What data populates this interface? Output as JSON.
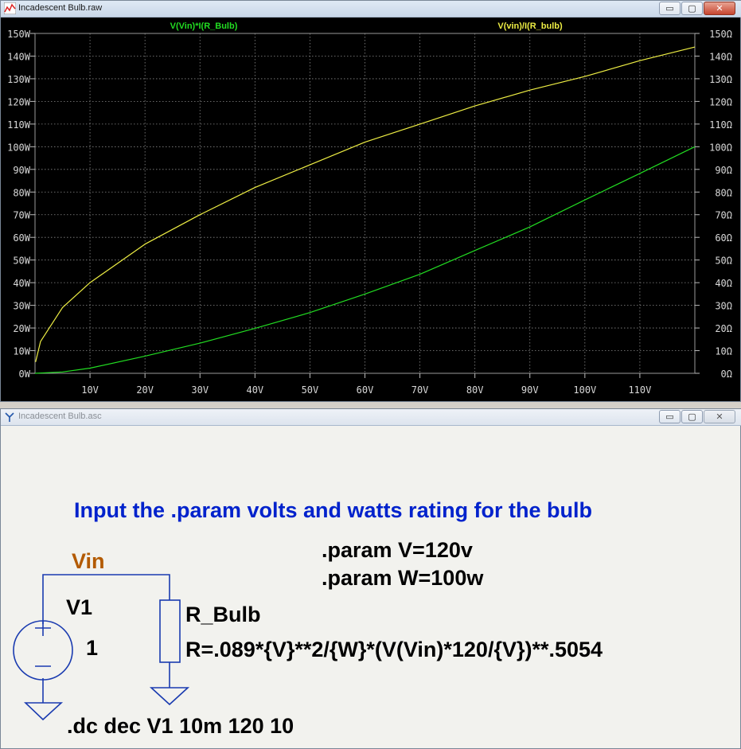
{
  "plot_window": {
    "title": "Incadescent Bulb.raw",
    "controls": {
      "minimize": "▭",
      "maximize": "▢",
      "close": "✕"
    }
  },
  "chart_data": {
    "type": "line",
    "xlabel": "",
    "xlim": [
      0,
      120
    ],
    "x_ticks": [
      "10V",
      "20V",
      "30V",
      "40V",
      "50V",
      "60V",
      "70V",
      "80V",
      "90V",
      "100V",
      "110V"
    ],
    "left_axis": {
      "ylim": [
        0,
        150
      ],
      "ticks": [
        "0W",
        "10W",
        "20W",
        "30W",
        "40W",
        "50W",
        "60W",
        "70W",
        "80W",
        "90W",
        "100W",
        "110W",
        "120W",
        "130W",
        "140W",
        "150W"
      ]
    },
    "right_axis": {
      "ylim": [
        0,
        150
      ],
      "ticks": [
        "0Ω",
        "10Ω",
        "20Ω",
        "30Ω",
        "40Ω",
        "50Ω",
        "60Ω",
        "70Ω",
        "80Ω",
        "90Ω",
        "100Ω",
        "110Ω",
        "120Ω",
        "130Ω",
        "140Ω",
        "150Ω"
      ]
    },
    "grid": true,
    "background": "#000000",
    "series": [
      {
        "name": "V(Vin)*I(R_Bulb)",
        "color": "#22dd22",
        "axis": "left",
        "x": [
          0,
          5,
          10,
          20,
          30,
          40,
          50,
          60,
          70,
          80,
          90,
          100,
          110,
          120
        ],
        "values": [
          0,
          0.6,
          2.3,
          7.6,
          13.3,
          19.8,
          26.8,
          35,
          43.7,
          54.2,
          64.6,
          76.5,
          88.2,
          100
        ]
      },
      {
        "name": "V(vin)/I(R_bulb)",
        "color": "#eeee44",
        "axis": "right",
        "x": [
          0.1,
          1,
          5,
          10,
          20,
          30,
          40,
          50,
          60,
          70,
          80,
          90,
          100,
          110,
          120
        ],
        "values": [
          5,
          14,
          29,
          40,
          57,
          70,
          82,
          92,
          102,
          110,
          118,
          125,
          131,
          138,
          144
        ]
      }
    ]
  },
  "schematic_window": {
    "title": "Incadescent Bulb.asc",
    "controls": {
      "minimize": "▭",
      "maximize": "▢",
      "close": "✕"
    },
    "heading": "Input the .param volts and watts rating for the bulb",
    "net_label": "Vin",
    "source_name": "V1",
    "source_value": "1",
    "resistor_name": "R_Bulb",
    "resistor_value": "R=.089*{V}**2/{W}*(V(Vin)*120/{V})**.5054",
    "param_v": ".param V=120v",
    "param_w": ".param W=100w",
    "dc_directive": ".dc dec V1 10m 120 10",
    "colors": {
      "heading": "#0022cc",
      "net_label": "#b35a00",
      "wire": "#1a3bb0",
      "text": "#000000"
    }
  }
}
